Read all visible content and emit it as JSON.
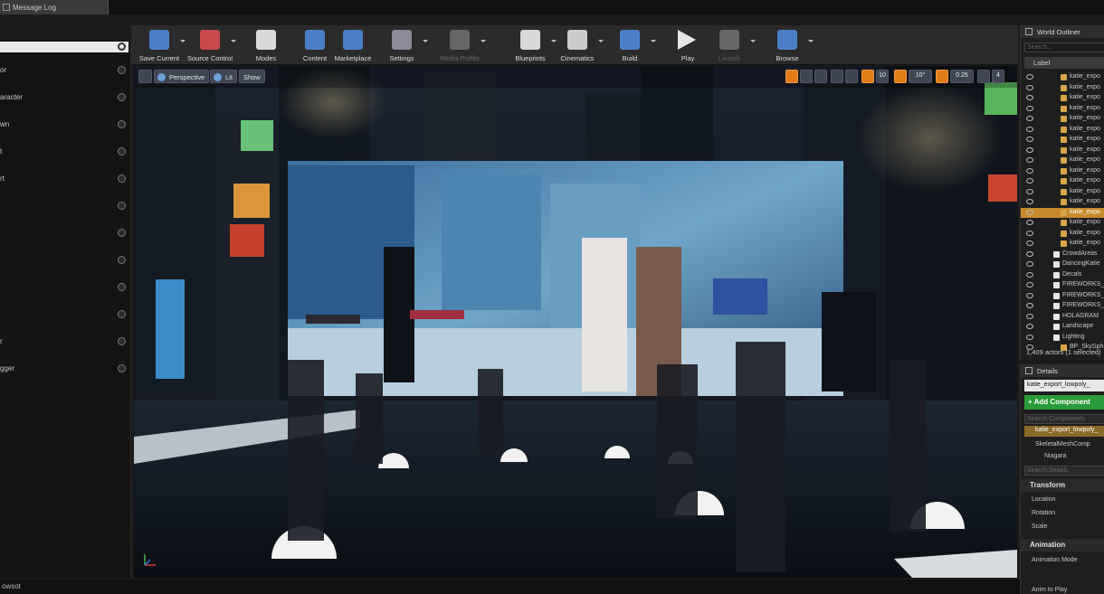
{
  "tab": {
    "label": "Message Log"
  },
  "left_panel": {
    "search_placeholder": "",
    "items": [
      "or",
      "aracter",
      "wn",
      "t",
      "rt",
      "",
      "",
      "",
      "",
      "",
      "r",
      "gger"
    ]
  },
  "toolbar": {
    "items": [
      {
        "label": "Save Current",
        "icon": "save-icon",
        "disabled": false
      },
      {
        "label": "Source Control",
        "icon": "source-control-icon",
        "disabled": false
      },
      {
        "label": "Modes",
        "icon": "modes-icon",
        "disabled": false
      },
      {
        "label": "Content",
        "icon": "content-icon",
        "disabled": false
      },
      {
        "label": "Marketplace",
        "icon": "marketplace-icon",
        "disabled": false
      },
      {
        "label": "Settings",
        "icon": "settings-icon",
        "disabled": false
      },
      {
        "label": "Media Profile",
        "icon": "media-profile-icon",
        "disabled": true
      },
      {
        "label": "Blueprints",
        "icon": "blueprints-icon",
        "disabled": false
      },
      {
        "label": "Cinematics",
        "icon": "cinematics-icon",
        "disabled": false
      },
      {
        "label": "Build",
        "icon": "build-icon",
        "disabled": false
      },
      {
        "label": "Play",
        "icon": "play-icon",
        "disabled": false
      },
      {
        "label": "Launch",
        "icon": "launch-icon",
        "disabled": true
      },
      {
        "label": "Browse",
        "icon": "browse-icon",
        "disabled": false
      }
    ]
  },
  "viewport": {
    "perspective_label": "Perspective",
    "lit_label": "Lit",
    "show_label": "Show",
    "grid_snap": "10",
    "rotation_snap": "10°",
    "scale_snap": "0.25",
    "camera_speed": "4"
  },
  "outliner": {
    "title": "World Outliner",
    "search_placeholder": "Search...",
    "column_label": "Label",
    "actor_rows": [
      "katie_expo",
      "katie_expo",
      "katie_expo",
      "katie_expo",
      "katie_expo",
      "katie_expo",
      "katie_expo",
      "katie_expo",
      "katie_expo",
      "katie_expo",
      "katie_expo",
      "katie_expo",
      "katie_expo"
    ],
    "selected_row": "katie_expo",
    "after_selected_rows": [
      "katie_expo",
      "katie_expo",
      "katie_expo"
    ],
    "folders": [
      "CrowdAreas",
      "DancingKatie",
      "Decals",
      "FIREWORKS_",
      "FIREWORKS_",
      "FIREWORKS_",
      "HOLAGRAM",
      "Landscape",
      "Lighting"
    ],
    "last_row": "BP_SkySph",
    "footer": "1,409 actors (1 selected)"
  },
  "details": {
    "title": "Details",
    "actor_name": "katie_export_lowpoly_",
    "add_component": "+ Add Component",
    "search_components": "Search Components",
    "selected_component": "katie_export_lowpoly_",
    "components": [
      "SkeletalMeshComp",
      "Niagara"
    ],
    "search_details": "Search Details",
    "transform_title": "Transform",
    "location": "Location",
    "rotation": "Rotation",
    "scale": "Scale",
    "animation_title": "Animation",
    "animation_mode": "Animation Mode",
    "anim_to_play": "Anim to Play"
  },
  "statusbar": {
    "text": "owsot"
  }
}
